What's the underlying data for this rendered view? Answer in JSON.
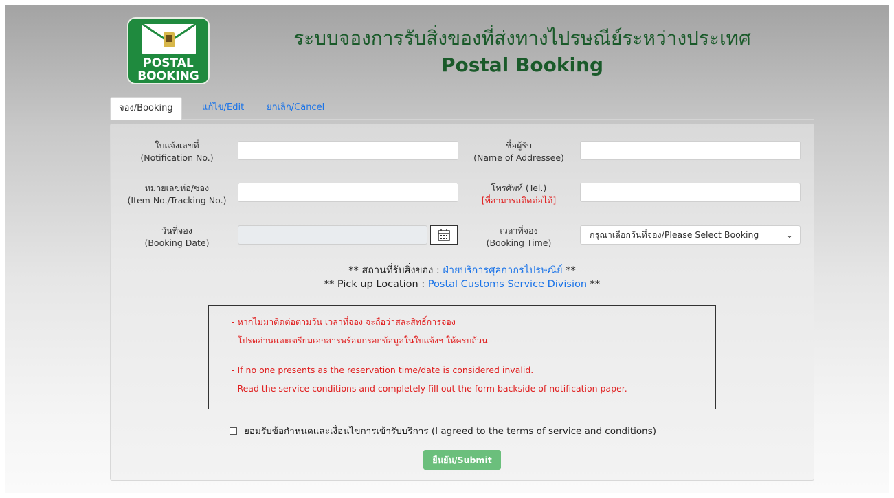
{
  "header": {
    "logo_line1": "POSTAL",
    "logo_line2": "BOOKING",
    "title_th": "ระบบจองการรับสิ่งของที่ส่งทางไปรษณีย์ระหว่างประเทศ",
    "title_en": "Postal Booking"
  },
  "tabs": [
    {
      "label": "จอง/Booking",
      "active": true
    },
    {
      "label": "แก้ไข/Edit",
      "active": false
    },
    {
      "label": "ยกเลิก/Cancel",
      "active": false
    }
  ],
  "form": {
    "notification_label_th": "ใบแจ้งเลขที่",
    "notification_label_en": "(Notification No.)",
    "notification_value": "",
    "addressee_label_th": "ชื่อผู้รับ",
    "addressee_label_en": "(Name of Addressee)",
    "addressee_value": "",
    "item_label_th": "หมายเลขห่อ/ซอง",
    "item_label_en": "(Item No./Tracking No.)",
    "item_value": "",
    "tel_label_th": "โทรศัพท์ (Tel.)",
    "tel_label_note": "[ที่สามารถติดต่อได้]",
    "tel_value": "",
    "date_label_th": "วันที่จอง",
    "date_label_en": "(Booking Date)",
    "date_value": "",
    "time_label_th": "เวลาที่จอง",
    "time_label_en": "(Booking Time)",
    "time_selected": "กรุณาเลือกวันที่จอง/Please Select Booking"
  },
  "location": {
    "th_prefix": "** สถานที่รับสิ่งของ :",
    "th_place": "ฝ่ายบริการศุลกากรไปรษณีย์",
    "th_suffix": "**",
    "en_prefix": "** Pick up Location :",
    "en_place": "Postal Customs Service Division",
    "en_suffix": "**"
  },
  "notice": {
    "lines": [
      "- หากไม่มาติดต่อตามวัน เวลาที่จอง จะถือว่าสละสิทธิ์การจอง",
      "- โปรดอ่านและเตรียมเอกสารพร้อมกรอกข้อมูลในใบแจ้งฯ ให้ครบถ้วน",
      "- If no one presents as the reservation time/date is considered invalid.",
      "- Read the service conditions and completely fill out the form backside of notification paper."
    ]
  },
  "agree_label": "ยอมรับข้อกำหนดและเงื่อนไขการเข้ารับบริการ (I agreed to the terms of service and conditions)",
  "submit_label": "ยืนยัน/Submit",
  "colors": {
    "brand_green": "#1f8a3e",
    "title_green": "#1a5a2a",
    "link_blue": "#1a73e8",
    "warning_red": "#e02020",
    "submit_green": "#6bbf7c"
  }
}
